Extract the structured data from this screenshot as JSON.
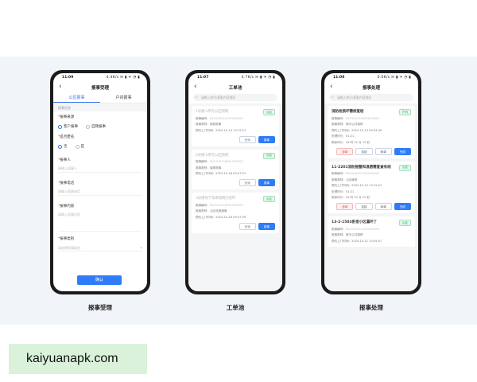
{
  "phone1": {
    "status": {
      "time": "11:09",
      "icons": "4.4K/s ✉ ▮ ✈ ◔ ▮"
    },
    "title": "报事受理",
    "tabs": [
      "公区报事",
      "户内报事"
    ],
    "section": "报事信息",
    "fields": {
      "source_label": "报事来源",
      "source_opt1": "客户报事",
      "source_opt2": "自我报事",
      "anon_label": "是否匿名",
      "anon_opt1": "否",
      "anon_opt2": "是",
      "reporter_label": "报事人",
      "reporter_placeholder": "请输入报事人",
      "phone_label": "报事电话",
      "phone_placeholder": "请输入报事电话",
      "content_label": "报事内容",
      "content_placeholder": "请输入报事内容",
      "type_label": "报事类别",
      "type_placeholder": "请选择报事类别"
    },
    "submit": "确认",
    "caption": "报事受理"
  },
  "phone2": {
    "status": {
      "time": "11:07",
      "icons": "4.7K/s ✉ ▮ ✈ ◔ ▮"
    },
    "title": "工单池",
    "search_placeholder": "请输入房号/报事内容搜索",
    "cards": [
      {
        "title": "1号楼-1单元公区照明",
        "badge": "公区",
        "lines": [
          {
            "k": "报事编号：",
            "v": "BS202410141522000001"
          },
          {
            "k": "报事类别：",
            "v": "保修报事"
          },
          {
            "k": "预约上门时间：",
            "v": "2024-10-14 15:22:21"
          }
        ],
        "buttons": [
          "分派",
          "报事"
        ]
      },
      {
        "title": "2号楼-2单元公区照明",
        "badge": "公区",
        "lines": [
          {
            "k": "报事编号：",
            "v": "BS202410180907000002"
          },
          {
            "k": "报事类别：",
            "v": "保修报事"
          },
          {
            "k": "预约上门时间：",
            "v": "2024-10-18 09:07:57"
          }
        ],
        "buttons": [
          "分派",
          "报事"
        ]
      },
      {
        "title": "3号楼地下车库照明灯损坏",
        "badge": "公区",
        "lines": [
          {
            "k": "报事编号：",
            "v": "BS202410180947000003"
          },
          {
            "k": "报事类别：",
            "v": "公区设施报事"
          },
          {
            "k": "预约上门时间：",
            "v": "2024-10-18 09:47:59"
          }
        ],
        "buttons": [
          "分派",
          "报事"
        ]
      }
    ],
    "caption": "工单池"
  },
  "phone3": {
    "status": {
      "time": "11:08",
      "icons": "0.0K/s ✉ ▮ ✈ ◔ ▮"
    },
    "title": "报事处理",
    "search_placeholder": "请输入房号/报事内容搜索",
    "cards": [
      {
        "title": "消防栓损坏需修复检",
        "badge": "户内",
        "lines": [
          {
            "k": "报事编号：",
            "v": "BS202410130934000004"
          },
          {
            "k": "报事类别：",
            "v": "家中公共维修"
          },
          {
            "k": "预约上门时间：",
            "v": "2024-10-13 09:34:49"
          },
          {
            "k": "处理时长：",
            "v": "01:21"
          },
          {
            "k": "剩余时长：",
            "v": "24 时 22 分 12 秒"
          }
        ],
        "buttons": [
          "退单",
          "挂起",
          "转单",
          "完成"
        ]
      },
      {
        "title": "11-2201消防报警和温感需复查有线",
        "badge": "公区",
        "lines": [
          {
            "k": "报事编号：",
            "v": "BS202410121312000005"
          },
          {
            "k": "报事类别：",
            "v": "公区维修"
          },
          {
            "k": "预约上门时间：",
            "v": "2024-10-12 13:12:21"
          },
          {
            "k": "处理时长：",
            "v": "01:21"
          },
          {
            "k": "剩余时长：",
            "v": "24 时 22 分 22 秒"
          }
        ],
        "buttons": [
          "退单",
          "挂起",
          "转单",
          "完成"
        ]
      },
      {
        "title": "13-2-1503卧室小区漏坏了",
        "badge": "公区",
        "lines": [
          {
            "k": "报事编号：",
            "v": "BS202410111505000006"
          },
          {
            "k": "报事类别：",
            "v": "家中公共维修"
          },
          {
            "k": "预约上门时间：",
            "v": "2024-10-11 15:05:07"
          }
        ],
        "buttons": []
      }
    ],
    "caption": "报事处理"
  },
  "watermark": "kaiyuanapk.com",
  "colors": {
    "primary": "#2f7cf6",
    "badge_green": "#1ba858",
    "danger": "#e04848",
    "panel_bg": "#f1f5f9",
    "watermark_bg": "#d9f2d9"
  }
}
